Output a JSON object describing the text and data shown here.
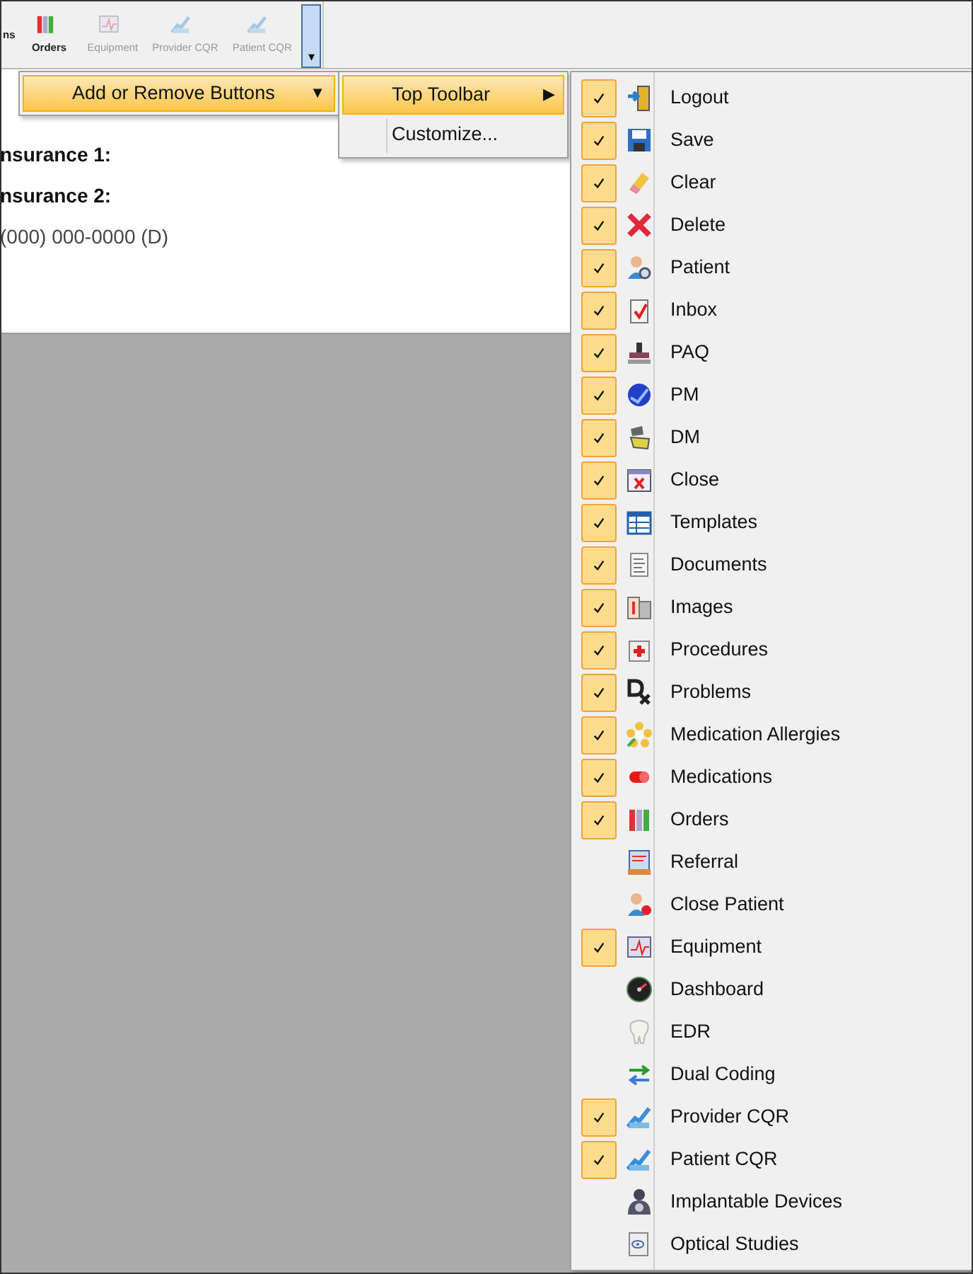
{
  "toolbar": {
    "buttons": [
      {
        "label": "ns",
        "disabled": false
      },
      {
        "label": "Orders",
        "disabled": false
      },
      {
        "label": "Equipment",
        "disabled": true
      },
      {
        "label": "Provider CQR",
        "disabled": true
      },
      {
        "label": "Patient CQR",
        "disabled": true
      }
    ],
    "overflow_button": {
      "glyph": "▾",
      "selected": true
    }
  },
  "content": {
    "lines": [
      {
        "label": "nsurance 1:"
      },
      {
        "label": "nsurance 2:"
      }
    ],
    "phone": "(000) 000-0000 (D)"
  },
  "menu": {
    "label": "Add or Remove Buttons",
    "arrow": "▼",
    "selected": true
  },
  "submenu": {
    "items": [
      {
        "label": "Top Toolbar",
        "arrow": "▶",
        "selected": true
      },
      {
        "label": "Customize...",
        "selected": false
      }
    ]
  },
  "buttons_menu": {
    "items": [
      {
        "label": "Logout",
        "checked": true
      },
      {
        "label": "Save",
        "checked": true
      },
      {
        "label": "Clear",
        "checked": true
      },
      {
        "label": "Delete",
        "checked": true
      },
      {
        "label": "Patient",
        "checked": true
      },
      {
        "label": "Inbox",
        "checked": true
      },
      {
        "label": "PAQ",
        "checked": true
      },
      {
        "label": "PM",
        "checked": true
      },
      {
        "label": "DM",
        "checked": true
      },
      {
        "label": "Close",
        "checked": true
      },
      {
        "label": "Templates",
        "checked": true
      },
      {
        "label": "Documents",
        "checked": true
      },
      {
        "label": "Images",
        "checked": true
      },
      {
        "label": "Procedures",
        "checked": true
      },
      {
        "label": "Problems",
        "checked": true
      },
      {
        "label": "Medication Allergies",
        "checked": true
      },
      {
        "label": "Medications",
        "checked": true
      },
      {
        "label": "Orders",
        "checked": true
      },
      {
        "label": "Referral",
        "checked": false
      },
      {
        "label": "Close Patient",
        "checked": false
      },
      {
        "label": "Equipment",
        "checked": true
      },
      {
        "label": "Dashboard",
        "checked": false
      },
      {
        "label": "EDR",
        "checked": false
      },
      {
        "label": "Dual Coding",
        "checked": false
      },
      {
        "label": "Provider CQR",
        "checked": true
      },
      {
        "label": "Patient CQR",
        "checked": true
      },
      {
        "label": "Implantable Devices",
        "checked": false
      },
      {
        "label": "Optical Studies",
        "checked": false
      }
    ]
  }
}
